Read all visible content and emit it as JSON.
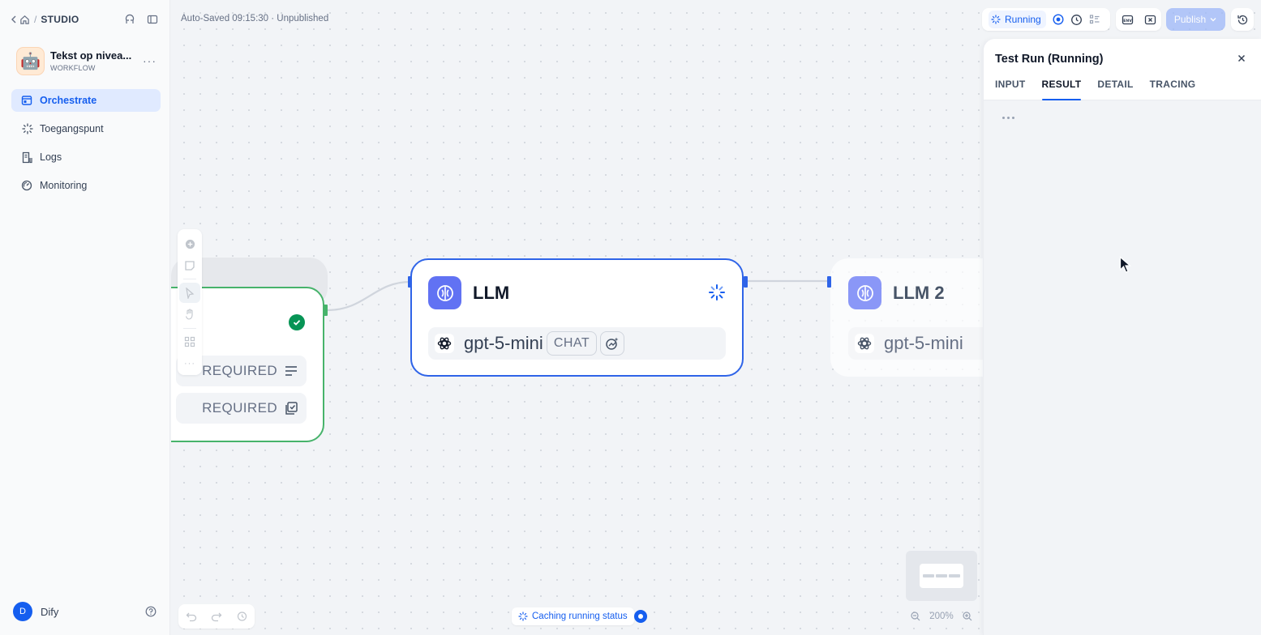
{
  "breadcrumb": {
    "section": "STUDIO"
  },
  "app": {
    "name": "Tekst op nivea...",
    "type": "WORKFLOW",
    "icon": "robot-emoji",
    "emoji": "🤖"
  },
  "nav": {
    "items": [
      {
        "label": "Orchestrate",
        "icon": "workflow-icon",
        "active": true
      },
      {
        "label": "Toegangspunt",
        "icon": "access-point-icon"
      },
      {
        "label": "Logs",
        "icon": "logs-icon"
      },
      {
        "label": "Monitoring",
        "icon": "monitoring-icon"
      }
    ]
  },
  "user": {
    "initial": "D",
    "name": "Dify"
  },
  "canvas": {
    "autosave": "Auto-Saved 09:15:30 · Unpublished",
    "start_node": {
      "rows": [
        "REQUIRED",
        "REQUIRED"
      ]
    },
    "llm_node": {
      "title": "LLM",
      "model": "gpt-5-mini",
      "mode": "CHAT",
      "status": "running"
    },
    "llm2_node": {
      "title": "LLM 2",
      "model": "gpt-5-mini"
    },
    "zoom": "200%",
    "cache_status": "Caching running status"
  },
  "toolbar": {
    "run_status": "Running",
    "publish": "Publish"
  },
  "panel": {
    "title": "Test Run (Running)",
    "tabs": [
      "INPUT",
      "RESULT",
      "DETAIL",
      "TRACING"
    ],
    "active_tab": "RESULT"
  },
  "colors": {
    "accent": "#155eef",
    "success": "#079455",
    "llm": "#6172f3"
  }
}
